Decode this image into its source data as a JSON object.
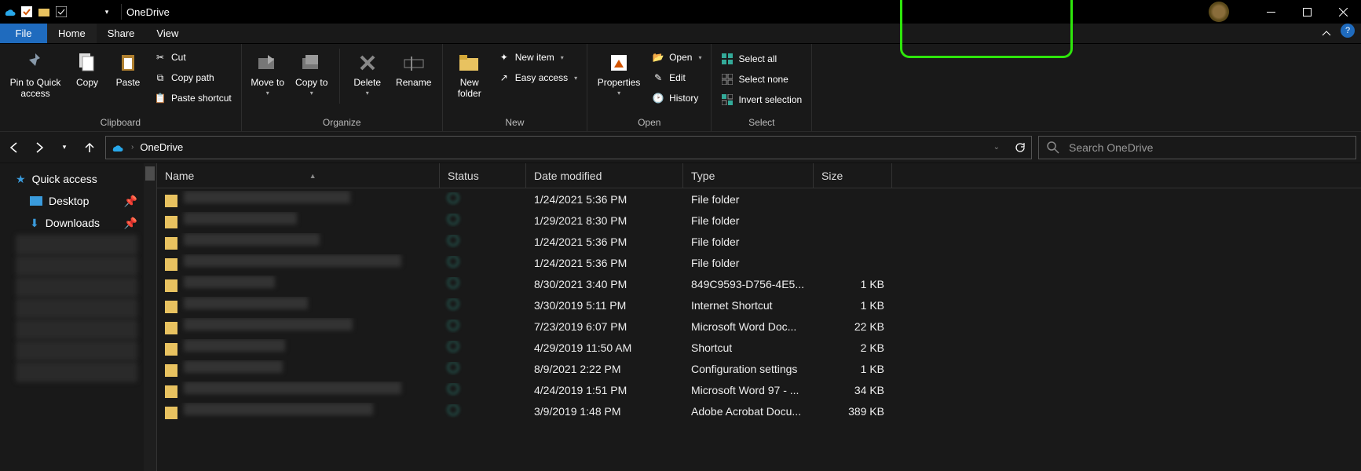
{
  "window": {
    "title": "OneDrive"
  },
  "tabs": {
    "file": "File",
    "home": "Home",
    "share": "Share",
    "view": "View"
  },
  "ribbon": {
    "clipboard": {
      "label": "Clipboard",
      "pin": "Pin to Quick access",
      "copy": "Copy",
      "paste": "Paste",
      "cut": "Cut",
      "copypath": "Copy path",
      "pasteshortcut": "Paste shortcut"
    },
    "organize": {
      "label": "Organize",
      "moveto": "Move to",
      "copyto": "Copy to",
      "delete": "Delete",
      "rename": "Rename"
    },
    "new": {
      "label": "New",
      "newfolder": "New folder",
      "newitem": "New item",
      "easyaccess": "Easy access"
    },
    "open": {
      "label": "Open",
      "properties": "Properties",
      "open": "Open",
      "edit": "Edit",
      "history": "History"
    },
    "select": {
      "label": "Select",
      "selectall": "Select all",
      "selectnone": "Select none",
      "invert": "Invert selection"
    }
  },
  "address": {
    "location": "OneDrive"
  },
  "search": {
    "placeholder": "Search OneDrive"
  },
  "sidebar": {
    "quickaccess": "Quick access",
    "desktop": "Desktop",
    "downloads": "Downloads"
  },
  "columns": {
    "name": "Name",
    "status": "Status",
    "date": "Date modified",
    "type": "Type",
    "size": "Size"
  },
  "files": [
    {
      "date": "1/24/2021 5:36 PM",
      "type": "File folder",
      "size": ""
    },
    {
      "date": "1/29/2021 8:30 PM",
      "type": "File folder",
      "size": ""
    },
    {
      "date": "1/24/2021 5:36 PM",
      "type": "File folder",
      "size": ""
    },
    {
      "date": "1/24/2021 5:36 PM",
      "type": "File folder",
      "size": ""
    },
    {
      "date": "8/30/2021 3:40 PM",
      "type": "849C9593-D756-4E5...",
      "size": "1 KB"
    },
    {
      "date": "3/30/2019 5:11 PM",
      "type": "Internet Shortcut",
      "size": "1 KB"
    },
    {
      "date": "7/23/2019 6:07 PM",
      "type": "Microsoft Word Doc...",
      "size": "22 KB"
    },
    {
      "date": "4/29/2019 11:50 AM",
      "type": "Shortcut",
      "size": "2 KB"
    },
    {
      "date": "8/9/2021 2:22 PM",
      "type": "Configuration settings",
      "size": "1 KB"
    },
    {
      "date": "4/24/2019 1:51 PM",
      "type": "Microsoft Word 97 - ...",
      "size": "34 KB"
    },
    {
      "date": "3/9/2019 1:48 PM",
      "type": "Adobe Acrobat Docu...",
      "size": "389 KB"
    }
  ]
}
